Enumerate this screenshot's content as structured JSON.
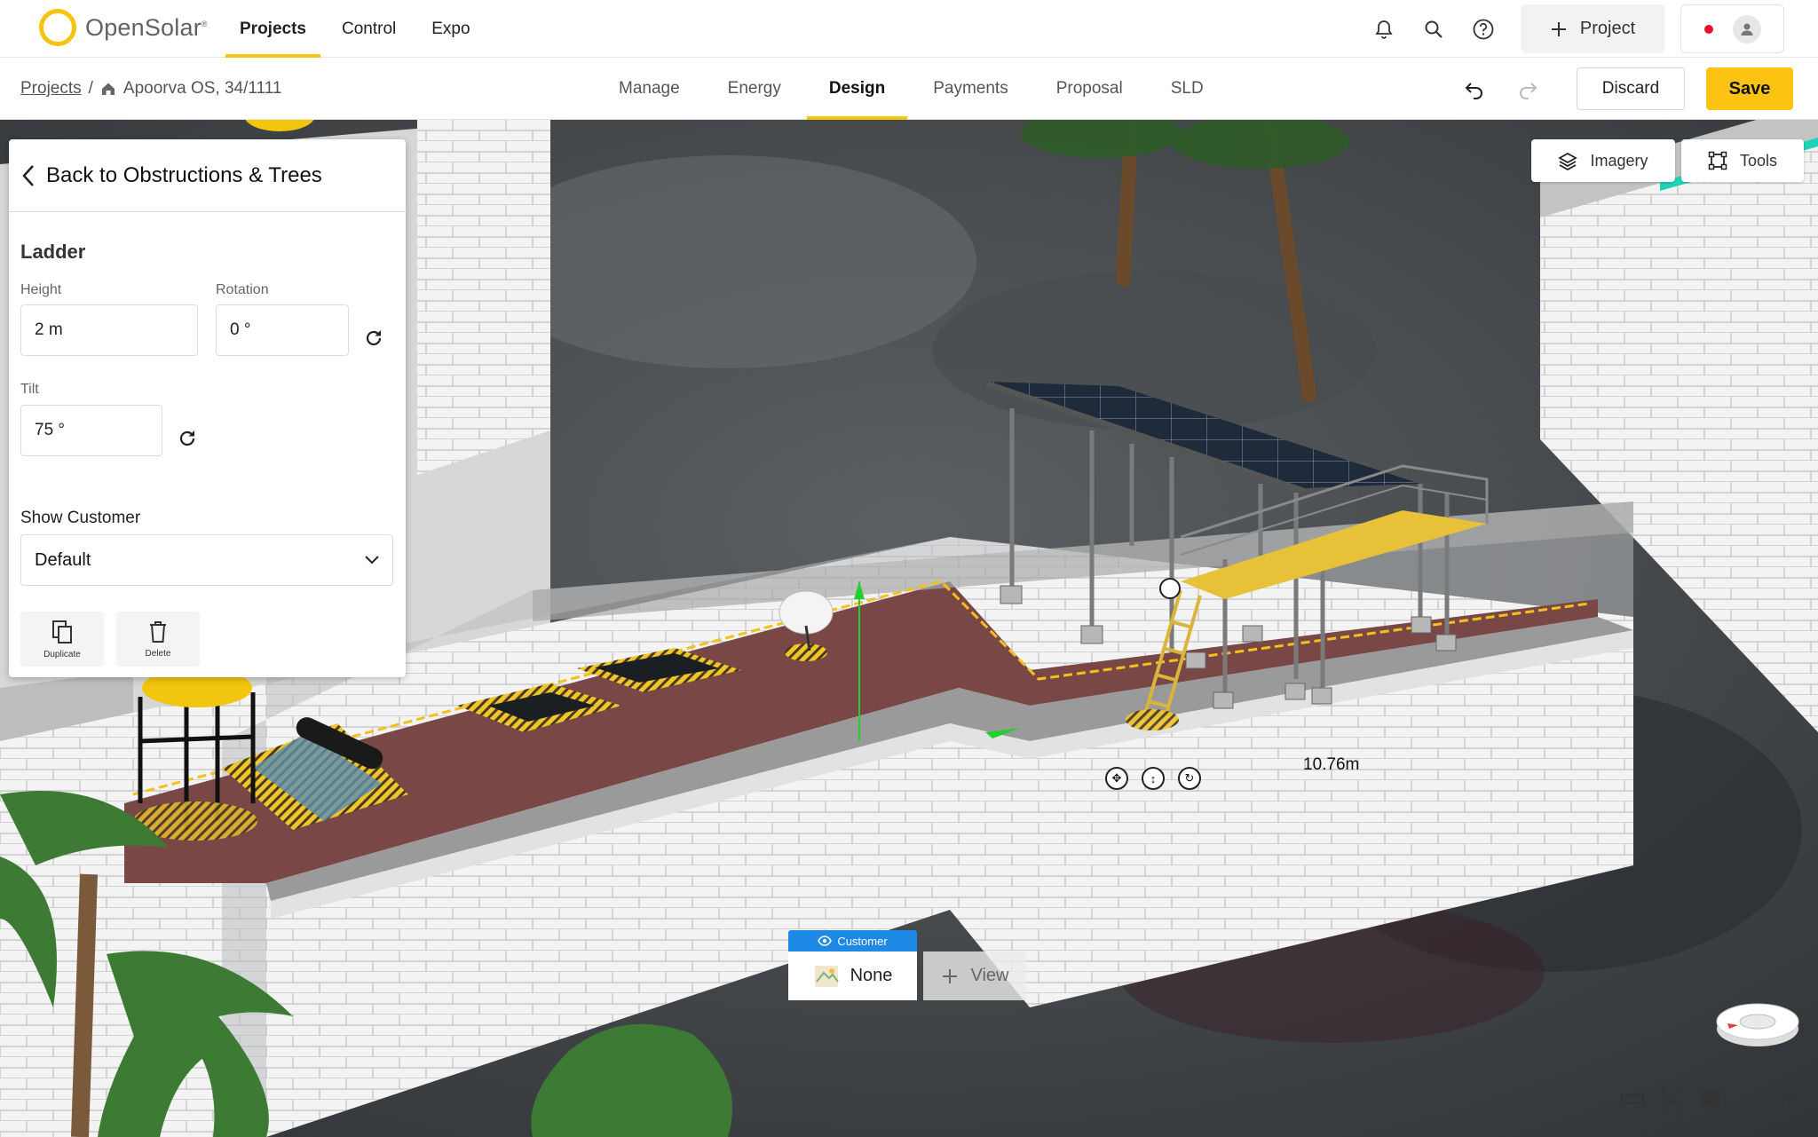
{
  "app": {
    "logo_text": "OpenSolar",
    "logo_mark": "®",
    "nav": [
      {
        "label": "Projects",
        "active": true
      },
      {
        "label": "Control",
        "active": false
      },
      {
        "label": "Expo",
        "active": false
      }
    ],
    "new_project_label": "Project"
  },
  "breadcrumb": {
    "root": "Projects",
    "separator": "/",
    "current": "Apoorva OS, 34/1111"
  },
  "tabs": [
    {
      "label": "Manage",
      "active": false
    },
    {
      "label": "Energy",
      "active": false
    },
    {
      "label": "Design",
      "active": true
    },
    {
      "label": "Payments",
      "active": false
    },
    {
      "label": "Proposal",
      "active": false
    },
    {
      "label": "SLD",
      "active": false
    }
  ],
  "actions": {
    "discard": "Discard",
    "save": "Save"
  },
  "viewport": {
    "imagery_label": "Imagery",
    "tools_label": "Tools",
    "measurement": "10.76m",
    "view_switch": {
      "tag": "Customer",
      "current": "None",
      "add_label": "View"
    }
  },
  "panel": {
    "back_label": "Back to Obstructions & Trees",
    "title": "Ladder",
    "height_label": "Height",
    "height_value": "2 m",
    "rotation_label": "Rotation",
    "rotation_value": "0 °",
    "tilt_label": "Tilt",
    "tilt_value": "75 °",
    "show_customer_label": "Show Customer",
    "show_customer_value": "Default",
    "duplicate_label": "Duplicate",
    "delete_label": "Delete"
  },
  "colors": {
    "accent": "#fcc313",
    "brand_ring": "#f6c311",
    "roof": "#7a4747",
    "customer_tag": "#1e88e5",
    "notification_dot": "#e8112d"
  }
}
